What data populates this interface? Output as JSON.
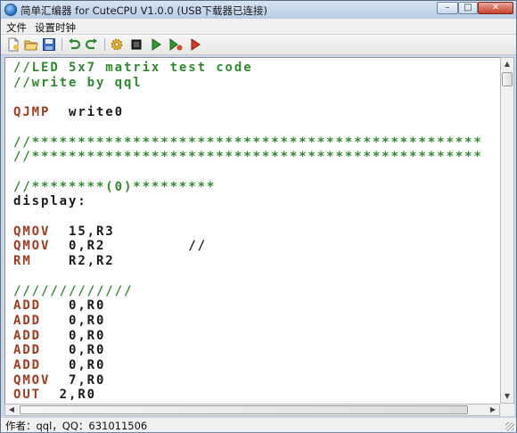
{
  "window": {
    "title": "简单汇编器 for CuteCPU  V1.0.0  (USB下载器已连接)",
    "controls": [
      "–",
      "□",
      "✕"
    ]
  },
  "menu": [
    "文件",
    "设置时钟"
  ],
  "toolbar": {
    "icons": [
      "new-file-icon",
      "open-folder-icon",
      "save-disk-icon",
      "undo-icon",
      "redo-icon",
      "gear-icon",
      "stop-icon",
      "run-icon",
      "step-icon",
      "download-icon"
    ]
  },
  "editor": {
    "lines": [
      [
        [
          "c",
          "//LED 5x7 matrix test code"
        ]
      ],
      [
        [
          "c",
          "//write by qql"
        ]
      ],
      [],
      [
        [
          "k",
          "QJMP"
        ],
        [
          "p",
          "  write0"
        ]
      ],
      [],
      [
        [
          "c",
          "//*************************************************"
        ]
      ],
      [
        [
          "c",
          "//*************************************************"
        ]
      ],
      [],
      [
        [
          "c",
          "//********(0)*********"
        ]
      ],
      [
        [
          "p",
          "display:"
        ]
      ],
      [],
      [
        [
          "k",
          "QMOV"
        ],
        [
          "p",
          "  15,R3"
        ]
      ],
      [
        [
          "k",
          "QMOV"
        ],
        [
          "p",
          "  0,R2         //"
        ]
      ],
      [
        [
          "k",
          "RM"
        ],
        [
          "p",
          "    R2,R2"
        ]
      ],
      [],
      [
        [
          "c",
          "/////////////"
        ]
      ],
      [
        [
          "k",
          "ADD"
        ],
        [
          "p",
          "   0,R0"
        ]
      ],
      [
        [
          "k",
          "ADD"
        ],
        [
          "p",
          "   0,R0"
        ]
      ],
      [
        [
          "k",
          "ADD"
        ],
        [
          "p",
          "   0,R0"
        ]
      ],
      [
        [
          "k",
          "ADD"
        ],
        [
          "p",
          "   0,R0"
        ]
      ],
      [
        [
          "k",
          "ADD"
        ],
        [
          "p",
          "   0,R0"
        ]
      ],
      [
        [
          "k",
          "QMOV"
        ],
        [
          "p",
          "  7,R0"
        ]
      ],
      [
        [
          "k",
          "OUT"
        ],
        [
          "p",
          "  2,R0"
        ]
      ]
    ]
  },
  "status": {
    "text": "作者：qql，QQ：631011506"
  }
}
